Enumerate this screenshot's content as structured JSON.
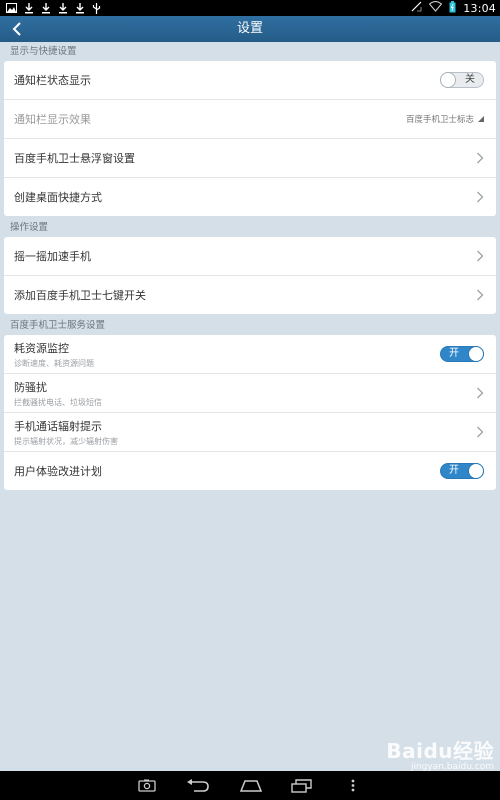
{
  "statusbar": {
    "time": "13:04"
  },
  "titlebar": {
    "title": "设置"
  },
  "sections": [
    {
      "header": "显示与快捷设置",
      "rows": [
        {
          "label": "通知栏状态显示",
          "type": "toggle",
          "state": "off",
          "toggle_label": "关"
        },
        {
          "label": "通知栏显示效果",
          "type": "dropdown",
          "value": "百度手机卫士标志",
          "disabled": true
        },
        {
          "label": "百度手机卫士悬浮窗设置",
          "type": "chevron"
        },
        {
          "label": "创建桌面快捷方式",
          "type": "chevron"
        }
      ]
    },
    {
      "header": "操作设置",
      "rows": [
        {
          "label": "摇一摇加速手机",
          "type": "chevron"
        },
        {
          "label": "添加百度手机卫士七键开关",
          "type": "chevron"
        }
      ]
    },
    {
      "header": "百度手机卫士服务设置",
      "rows": [
        {
          "label": "耗资源监控",
          "sub": "诊断速度、耗资源问题",
          "type": "toggle",
          "state": "on",
          "toggle_label": "开"
        },
        {
          "label": "防骚扰",
          "sub": "拦截骚扰电话、垃圾短信",
          "type": "chevron"
        },
        {
          "label": "手机通话辐射提示",
          "sub": "提示辐射状况，减少辐射伤害",
          "type": "chevron"
        },
        {
          "label": "用户体验改进计划",
          "type": "toggle",
          "state": "on",
          "toggle_label": "开"
        }
      ]
    }
  ],
  "watermark": {
    "logo": "Baidu经验",
    "url": "jingyan.baidu.com"
  },
  "colors": {
    "titlebar": "#2a66950",
    "accent": "#2f86c9",
    "background": "#d5dfe7"
  }
}
